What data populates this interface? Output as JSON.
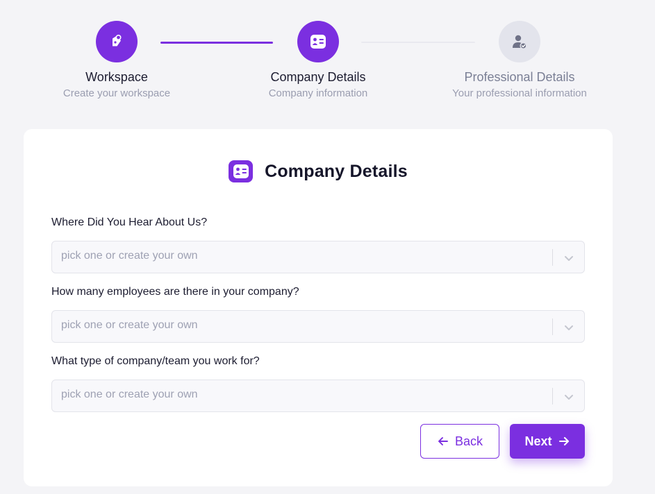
{
  "colors": {
    "accent": "#7b2fe0",
    "inactive_step": "#e3e4ec",
    "background": "#f4f4f7"
  },
  "stepper": {
    "steps": [
      {
        "title": "Workspace",
        "subtitle": "Create your workspace",
        "state": "completed",
        "icon": "edit-tag-icon"
      },
      {
        "title": "Company Details",
        "subtitle": "Company information",
        "state": "active",
        "icon": "id-card-icon"
      },
      {
        "title": "Professional Details",
        "subtitle": "Your professional information",
        "state": "pending",
        "icon": "user-check-icon"
      }
    ]
  },
  "form": {
    "title": "Company Details",
    "title_icon": "id-card-icon",
    "fields": [
      {
        "label": "Where Did You Hear About Us?",
        "placeholder": "pick one or create your own"
      },
      {
        "label": "How many employees are there in your company?",
        "placeholder": "pick one or create your own"
      },
      {
        "label": "What type of company/team you work for?",
        "placeholder": "pick one or create your own"
      }
    ],
    "back_label": "Back",
    "next_label": "Next"
  }
}
